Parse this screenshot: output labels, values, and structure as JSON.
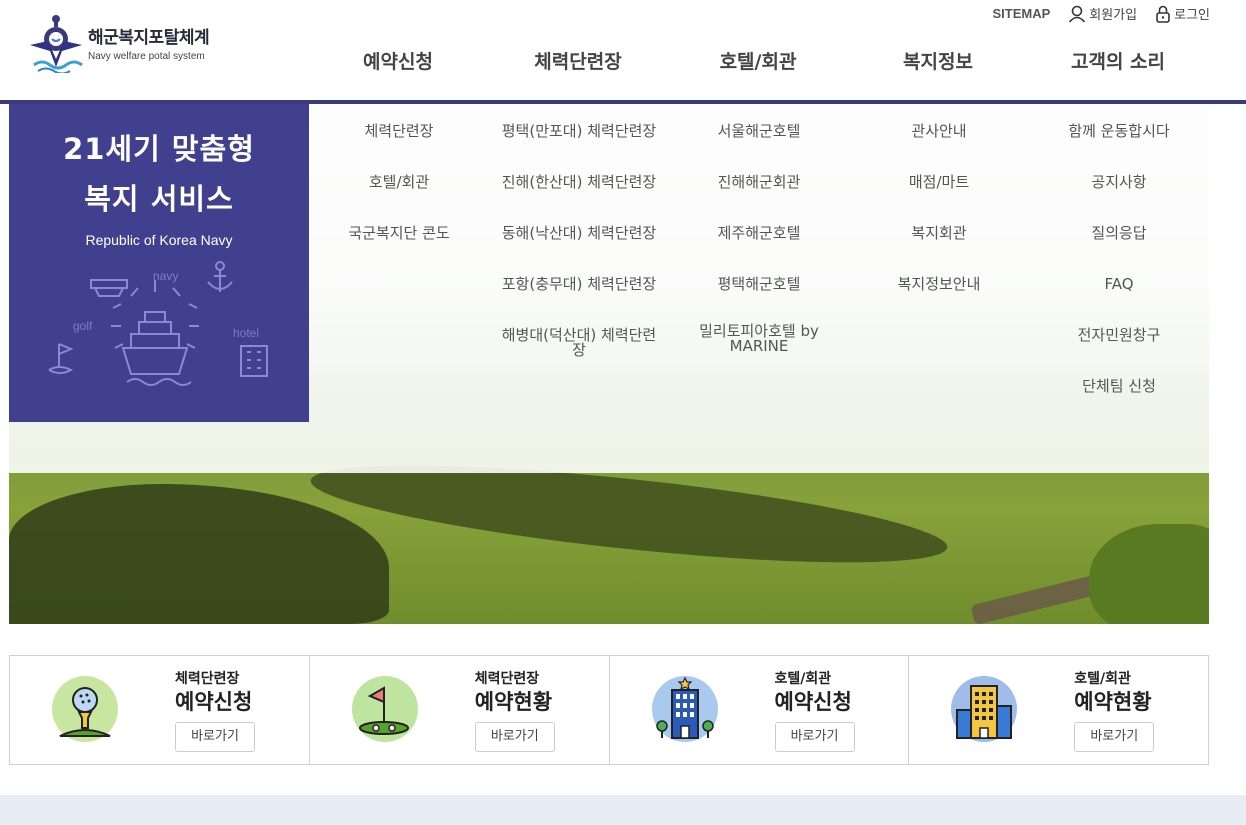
{
  "logo": {
    "title": "해군복지포탈체계",
    "subtitle": "Navy welfare potal system"
  },
  "util": {
    "sitemap": "SITEMAP",
    "join": "회원가입",
    "login": "로그인"
  },
  "gnb": [
    "예약신청",
    "체력단련장",
    "호텔/회관",
    "복지정보",
    "고객의 소리"
  ],
  "mega": {
    "headline1": "21세기 맞춤형",
    "headline2": "복지 서비스",
    "en": "Republic of Korea Navy",
    "art_labels": {
      "navy": "navy",
      "golf": "golf",
      "hotel": "hotel"
    },
    "columns": [
      [
        "체력단련장",
        "호텔/회관",
        "국군복지단 콘도"
      ],
      [
        "평택(만포대) 체력단련장",
        "진해(한산대) 체력단련장",
        "동해(낙산대) 체력단련장",
        "포항(충무대) 체력단련장",
        "해병대(덕산대) 체력단련장"
      ],
      [
        "서울해군호텔",
        "진해해군회관",
        "제주해군호텔",
        "평택해군호텔",
        "밀리토피아호텔 by MARINE"
      ],
      [
        "관사안내",
        "매점/마트",
        "복지회관",
        "복지정보안내"
      ],
      [
        "함께 운동합시다",
        "공지사항",
        "질의응답",
        "FAQ",
        "전자민원창구",
        "단체팀 신청"
      ]
    ]
  },
  "quick": [
    {
      "category": "체력단련장",
      "title": "예약신청",
      "button": "바로가기",
      "icon": "golf-ball-icon",
      "color": "#c8e6a0"
    },
    {
      "category": "체력단련장",
      "title": "예약현황",
      "button": "바로가기",
      "icon": "golf-flag-icon",
      "color": "#bfe4a0"
    },
    {
      "category": "호텔/회관",
      "title": "예약신청",
      "button": "바로가기",
      "icon": "hotel-building-icon",
      "color": "#a9c9ee"
    },
    {
      "category": "호텔/회관",
      "title": "예약현황",
      "button": "바로가기",
      "icon": "apartment-building-icon",
      "color": "#9fbde8"
    }
  ],
  "colors": {
    "brand": "#40408f",
    "header_line": "#3a3a7c"
  }
}
